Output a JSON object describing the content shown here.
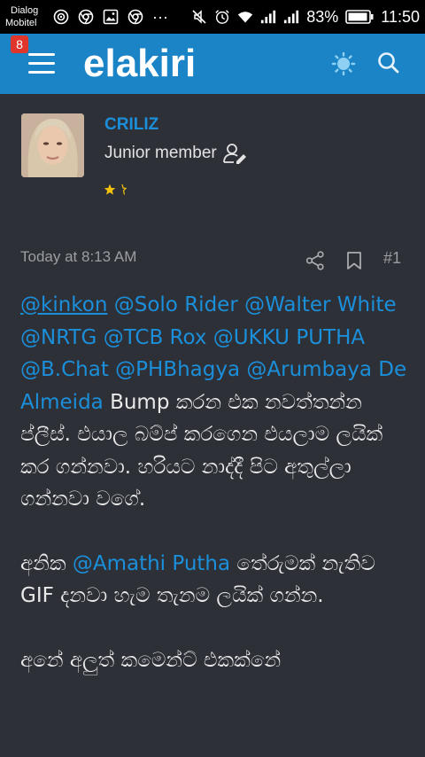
{
  "status_bar": {
    "carrier_line1": "Dialog",
    "carrier_line2": "Mobitel",
    "more": "···",
    "battery_percent": "83%",
    "time": "11:50"
  },
  "app_bar": {
    "notification_count": "8",
    "logo_text": "elakiri"
  },
  "post": {
    "username": "CRILIZ",
    "rank": "Junior member",
    "timestamp": "Today at 8:13 AM",
    "post_number": "#1",
    "paragraph1": {
      "mentions": [
        "@kinkon",
        "@Solo Rider",
        "@Walter White",
        "@NRTG",
        "@TCB Rox",
        "@UKKU PUTHA",
        "@B.Chat",
        "@PHBhagya",
        "@Arumbaya De Almeida"
      ],
      "text": "Bump කරන එක නවත්තන්න ප්ලීස්. එයාල බම්ප් කරගෙන එයලාම ලයික් කර ගන්නවා. හරියට නාද්දී පිට අතුල්ලා ගන්නවා වගේ."
    },
    "paragraph2": {
      "prefix": "අනික",
      "mention": "@Amathi Putha",
      "text": "තේරුමක් නැතිව GIF දනවා හැම තැනම ලයික් ගන්න."
    },
    "paragraph3": {
      "text": "අනේ අලුත් කමෙන්ට් එකක්නේ"
    }
  },
  "icons": {
    "menu": "hamburger-icon",
    "theme": "theme-toggle-icon",
    "search": "search-icon",
    "share": "share-icon",
    "bookmark": "bookmark-icon",
    "rank": "user-edit-icon"
  },
  "colors": {
    "app_bar": "#1a84c7",
    "background": "#2e3038",
    "link": "#1b8fd9",
    "badge": "#e0352b"
  }
}
